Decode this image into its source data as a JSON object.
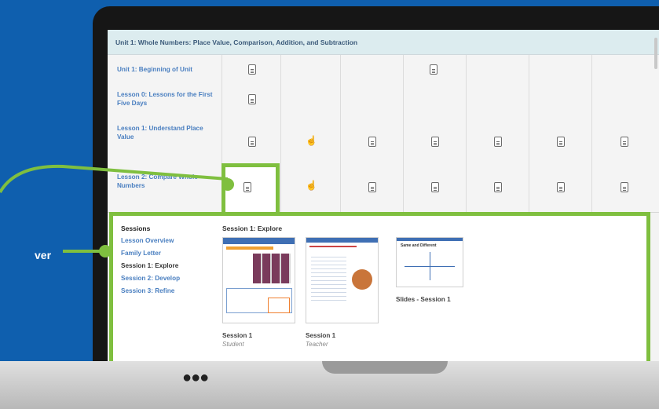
{
  "unit_header": "Unit 1: Whole Numbers: Place Value, Comparison, Addition, and Subtraction",
  "rows": [
    {
      "label": "Unit 1: Beginning of Unit"
    },
    {
      "label": "Lesson 0: Lessons for the First Five Days"
    },
    {
      "label": "Lesson 1: Understand Place Value"
    },
    {
      "label": "Lesson 2: Compare Whole Numbers"
    }
  ],
  "hover_label": "ver",
  "panel": {
    "sessions_title": "Sessions",
    "session_title": "Session 1: Explore",
    "links": [
      {
        "label": "Lesson Overview",
        "active": false
      },
      {
        "label": "Family Letter",
        "active": false
      },
      {
        "label": "Session 1: Explore",
        "active": true
      },
      {
        "label": "Session 2: Develop",
        "active": false
      },
      {
        "label": "Session 3: Refine",
        "active": false
      }
    ],
    "thumbnails": [
      {
        "title": "Session 1",
        "subtitle": "Student"
      },
      {
        "title": "Session 1",
        "subtitle": "Teacher"
      },
      {
        "title": "Slides - Session 1",
        "subtitle": ""
      }
    ],
    "slide_heading": "Same and Different"
  },
  "colors": {
    "accent_green": "#7fbf3f",
    "link_blue": "#4a7fc0",
    "background_blue": "#0f5fae"
  },
  "icons": [
    "document-icon",
    "hand-pointer-icon"
  ]
}
